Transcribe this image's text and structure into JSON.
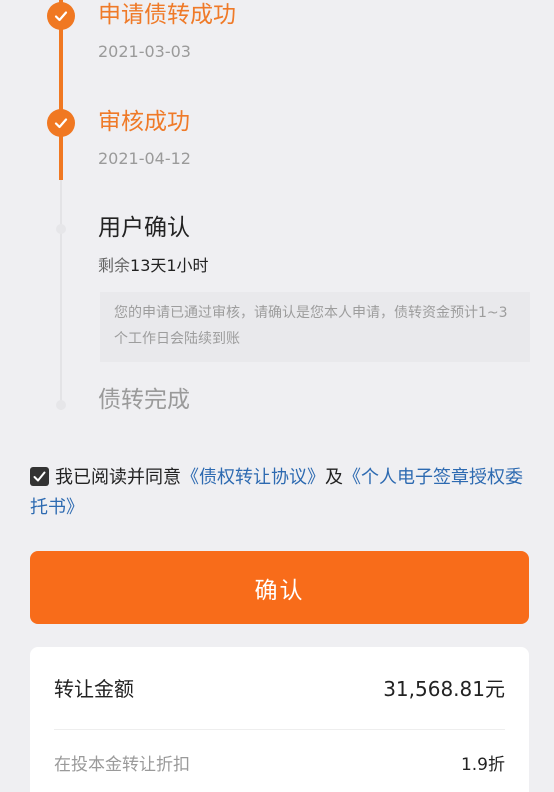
{
  "steps": [
    {
      "title": "申请债转成功",
      "date": "2021-03-03"
    },
    {
      "title": "审核成功",
      "date": "2021-04-12"
    },
    {
      "title": "用户确认",
      "remain_prefix": "剩余",
      "remain_value": "13天1小时",
      "notice": "您的申请已通过审核，请确认是您本人申请，债转资金预计1~3个工作日会陆续到账"
    },
    {
      "title": "债转完成"
    }
  ],
  "agreement": {
    "checked": true,
    "text": "我已阅读并同意",
    "link1": "《债权转让协议》",
    "and": "及",
    "link2": "《个人电子签章授权委托书》"
  },
  "confirm_label": "确认",
  "summary": {
    "amount_label": "转让金额",
    "amount_value": "31,568.81元",
    "discount_label": "在投本金转让折扣",
    "discount_value": "1.9折"
  },
  "colors": {
    "accent": "#f07822",
    "button": "#f86c1a",
    "link": "#2d6ab1"
  }
}
